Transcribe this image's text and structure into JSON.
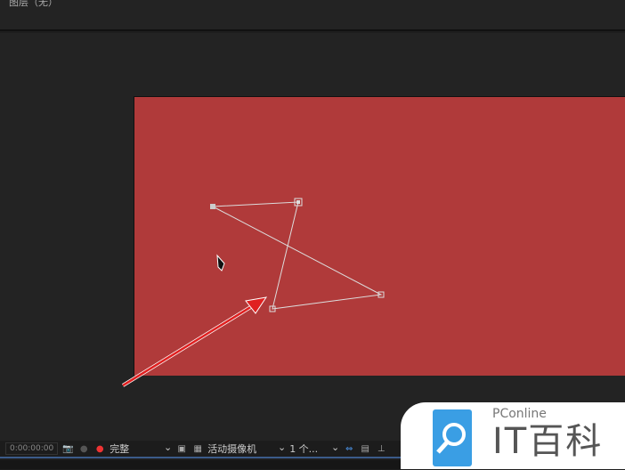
{
  "header": {
    "title": "图层（无）"
  },
  "colors": {
    "comp_bg": "#b03a3a",
    "accent": "#3b5b8a",
    "arrow": "#e02020"
  },
  "toolbar": {
    "timecode": "0:00:00:00",
    "resolution": "完整",
    "camera": "活动摄像机",
    "views": "1 个..."
  },
  "logo": {
    "brand": "PConline",
    "name": "IT百科"
  }
}
